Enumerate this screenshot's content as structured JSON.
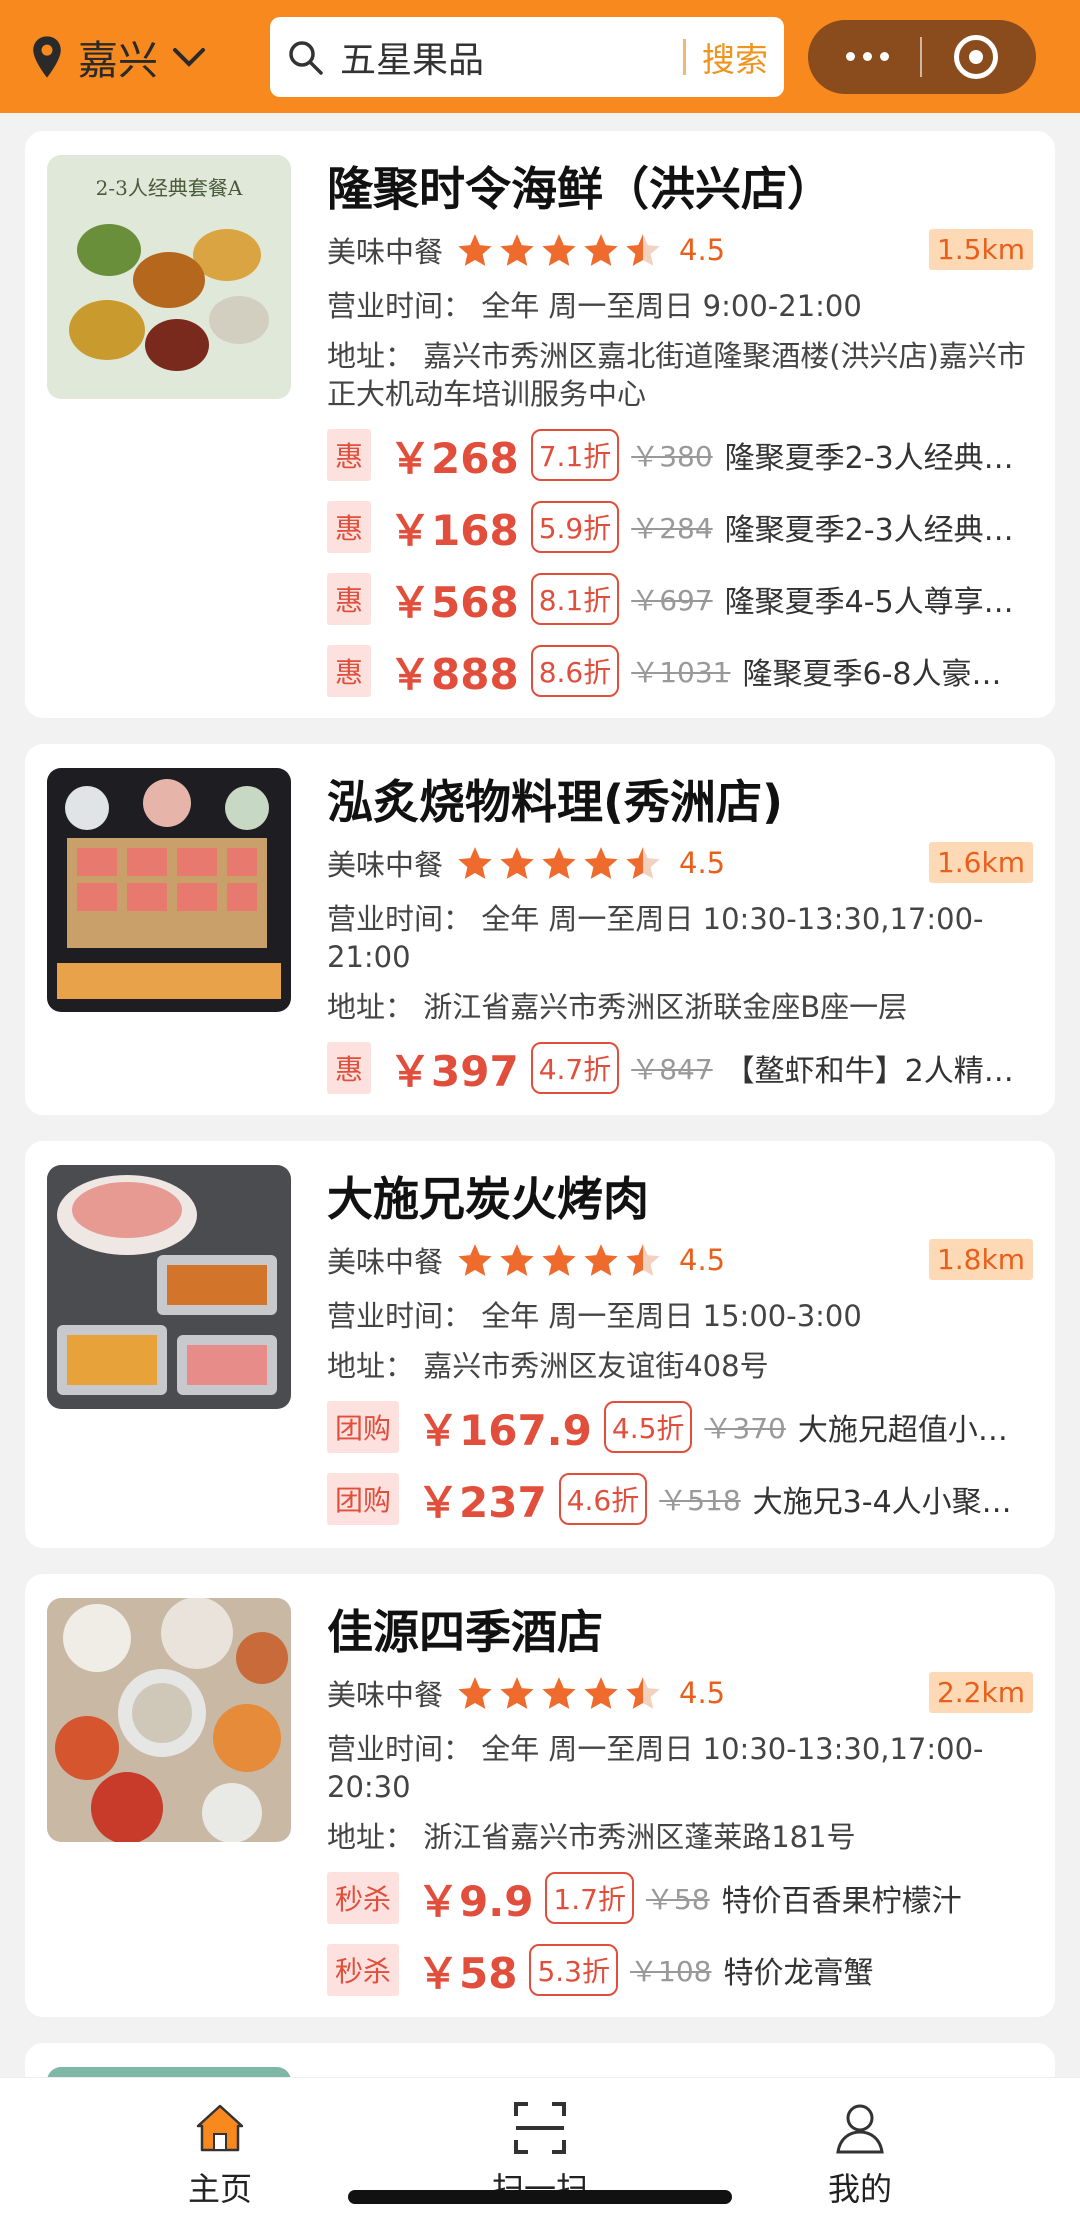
{
  "header": {
    "city": "嘉兴",
    "search_text": "五星果品",
    "search_button": "搜索",
    "colors": {
      "brand": "#f7891f",
      "capsule": "#8a4c1c"
    }
  },
  "restaurants": [
    {
      "name": "隆聚时令海鲜（洪兴店）",
      "category": "美味中餐",
      "score": "4.5",
      "distance": "1.5km",
      "hours": "营业时间：  全年  周一至周日 9:00-21:00",
      "address": "地址：  嘉兴市秀洲区嘉北街道隆聚酒楼(洪兴店)嘉兴市正大机动车培训服务中心",
      "thumb_caption": "2-3人经典套餐A",
      "deals": [
        {
          "tag": "惠",
          "price": "￥268",
          "discount": "7.1折",
          "original": "￥380",
          "name": "隆聚夏季2-3人经典…"
        },
        {
          "tag": "惠",
          "price": "￥168",
          "discount": "5.9折",
          "original": "￥284",
          "name": "隆聚夏季2-3人经典…"
        },
        {
          "tag": "惠",
          "price": "￥568",
          "discount": "8.1折",
          "original": "￥697",
          "name": "隆聚夏季4-5人尊享…"
        },
        {
          "tag": "惠",
          "price": "￥888",
          "discount": "8.6折",
          "original": "￥1031",
          "name": "隆聚夏季6-8人豪…"
        }
      ]
    },
    {
      "name": "泓炙烧物料理(秀洲店)",
      "category": "美味中餐",
      "score": "4.5",
      "distance": "1.6km",
      "hours": "营业时间：  全年  周一至周日 10:30-13:30,17:00-21:00",
      "address": "地址：  浙江省嘉兴市秀洲区浙联金座B座一层",
      "deals": [
        {
          "tag": "惠",
          "price": "￥397",
          "discount": "4.7折",
          "original": "￥847",
          "name": "【鳌虾和牛】2人精…"
        }
      ]
    },
    {
      "name": "大施兄炭火烤肉",
      "category": "美味中餐",
      "score": "4.5",
      "distance": "1.8km",
      "hours": "营业时间：  全年  周一至周日 15:00-3:00",
      "address": "地址：  嘉兴市秀洲区友谊街408号",
      "deals": [
        {
          "tag": "团购",
          "price": "￥167.9",
          "discount": "4.5折",
          "original": "￥370",
          "name": "大施兄超值小…"
        },
        {
          "tag": "团购",
          "price": "￥237",
          "discount": "4.6折",
          "original": "￥518",
          "name": "大施兄3-4人小聚…"
        }
      ]
    },
    {
      "name": "佳源四季酒店",
      "category": "美味中餐",
      "score": "4.5",
      "distance": "2.2km",
      "hours": "营业时间：  全年  周一至周日 10:30-13:30,17:00-20:30",
      "address": "地址：  浙江省嘉兴市秀洲区蓬莱路181号",
      "deals": [
        {
          "tag": "秒杀",
          "price": "￥9.9",
          "discount": "1.7折",
          "original": "￥58",
          "name": "特价百香果柠檬汁"
        },
        {
          "tag": "秒杀",
          "price": "￥58",
          "discount": "5.3折",
          "original": "￥108",
          "name": "特价龙膏蟹"
        }
      ]
    }
  ],
  "nav": {
    "home": "主页",
    "scan": "扫一扫",
    "mine": "我的"
  }
}
